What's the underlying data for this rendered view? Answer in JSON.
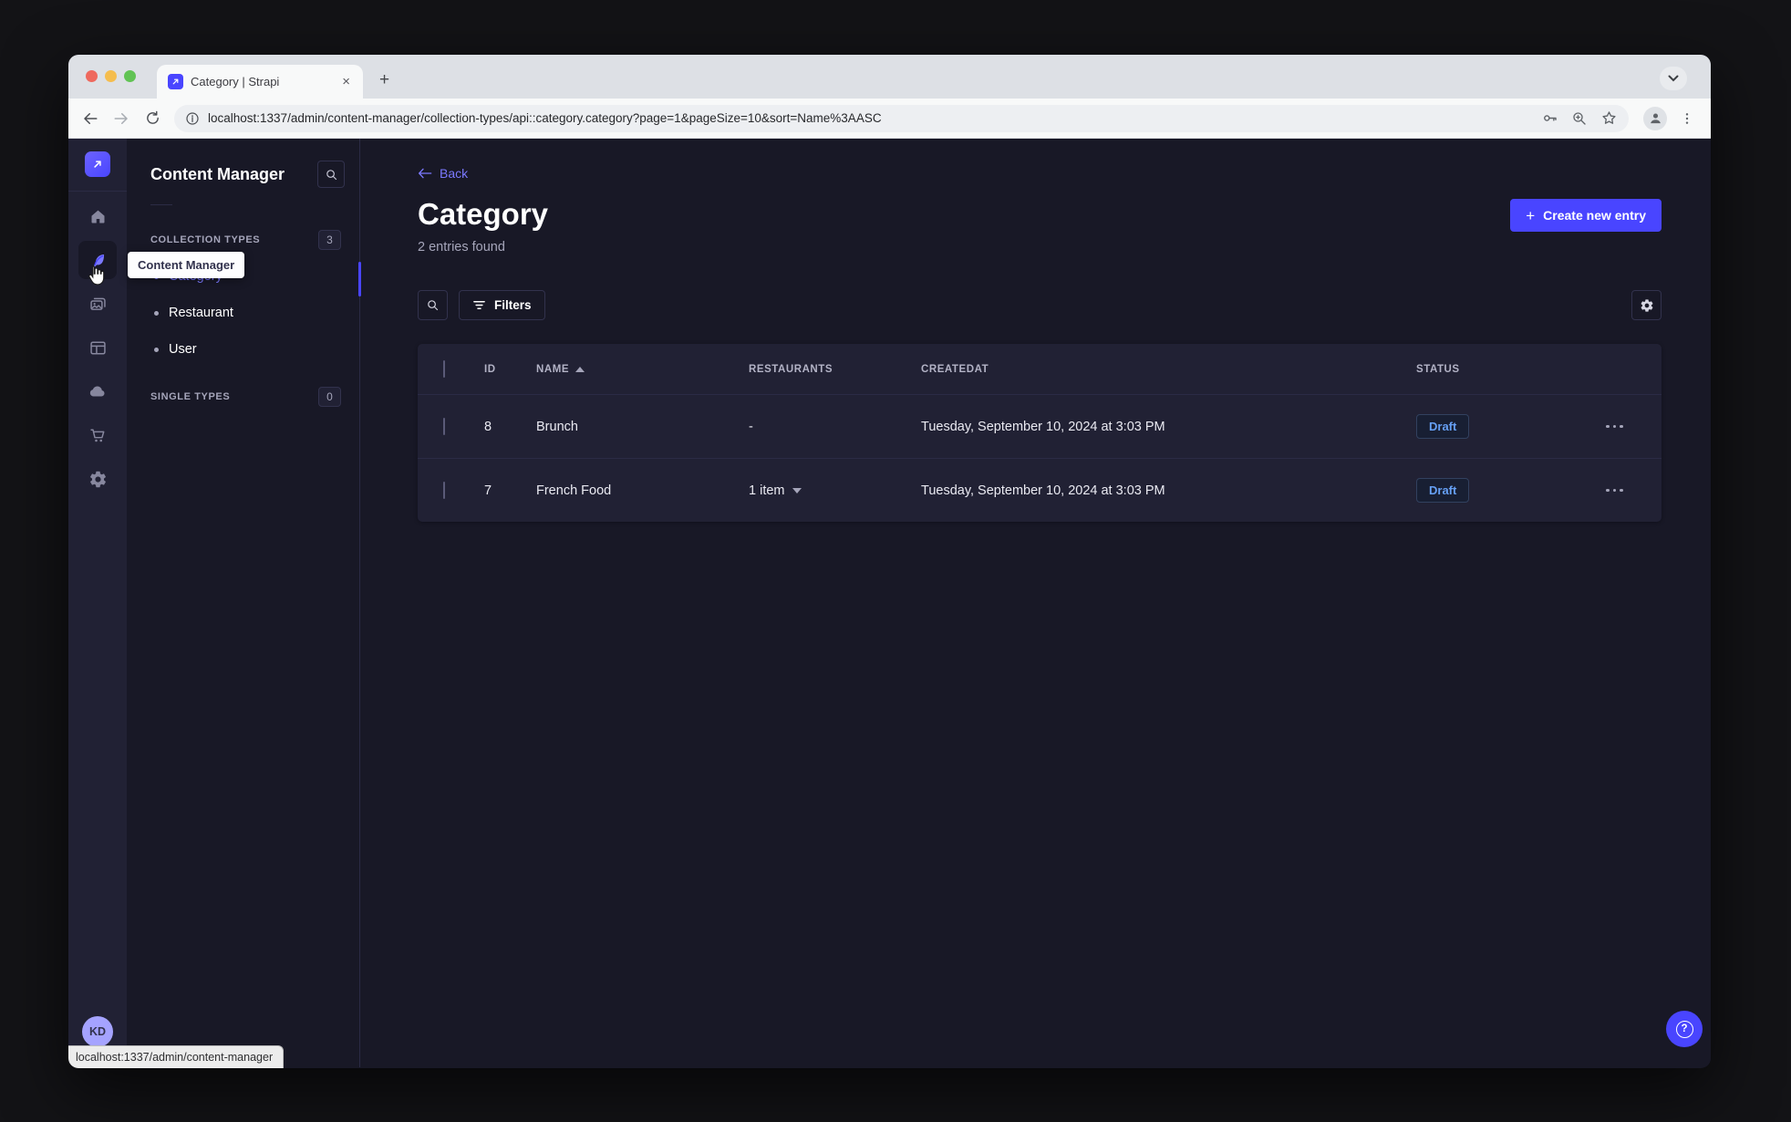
{
  "browser": {
    "tab_title": "Category | Strapi",
    "url": "localhost:1337/admin/content-manager/collection-types/api::category.category?page=1&pageSize=10&sort=Name%3AASC",
    "status_bar": "localhost:1337/admin/content-manager"
  },
  "nav_rail": {
    "avatar_initials": "KD",
    "active_item": "content-manager",
    "tooltip": "Content Manager"
  },
  "subnav": {
    "title": "Content Manager",
    "collection_types": {
      "label": "COLLECTION TYPES",
      "badge": "3",
      "items": [
        {
          "label": "Category",
          "active": true
        },
        {
          "label": "Restaurant",
          "active": false
        },
        {
          "label": "User",
          "active": false
        }
      ]
    },
    "single_types": {
      "label": "SINGLE TYPES",
      "badge": "0"
    }
  },
  "main": {
    "back_label": "Back",
    "title": "Category",
    "subtitle": "2 entries found",
    "create_button": "Create new entry",
    "filters_button": "Filters",
    "table": {
      "headers": {
        "id": "ID",
        "name": "NAME",
        "restaurants": "RESTAURANTS",
        "createdat": "CREATEDAT",
        "status": "STATUS"
      },
      "sort_column": "NAME",
      "sort_direction": "ASC",
      "rows": [
        {
          "id": "8",
          "name": "Brunch",
          "restaurants": "-",
          "createdat": "Tuesday, September 10, 2024 at 3:03 PM",
          "status": "Draft"
        },
        {
          "id": "7",
          "name": "French Food",
          "restaurants": "1 item",
          "createdat": "Tuesday, September 10, 2024 at 3:03 PM",
          "status": "Draft"
        }
      ]
    }
  },
  "icons": {
    "plus": "+",
    "close_tab": "×",
    "help": "?"
  },
  "colors": {
    "primary": "#4945ff",
    "link": "#7b79ff",
    "page_bg": "#181826",
    "surface": "#212134",
    "border": "#32324d",
    "muted_text": "#a5a5ba",
    "draft_text": "#66a0f5"
  }
}
